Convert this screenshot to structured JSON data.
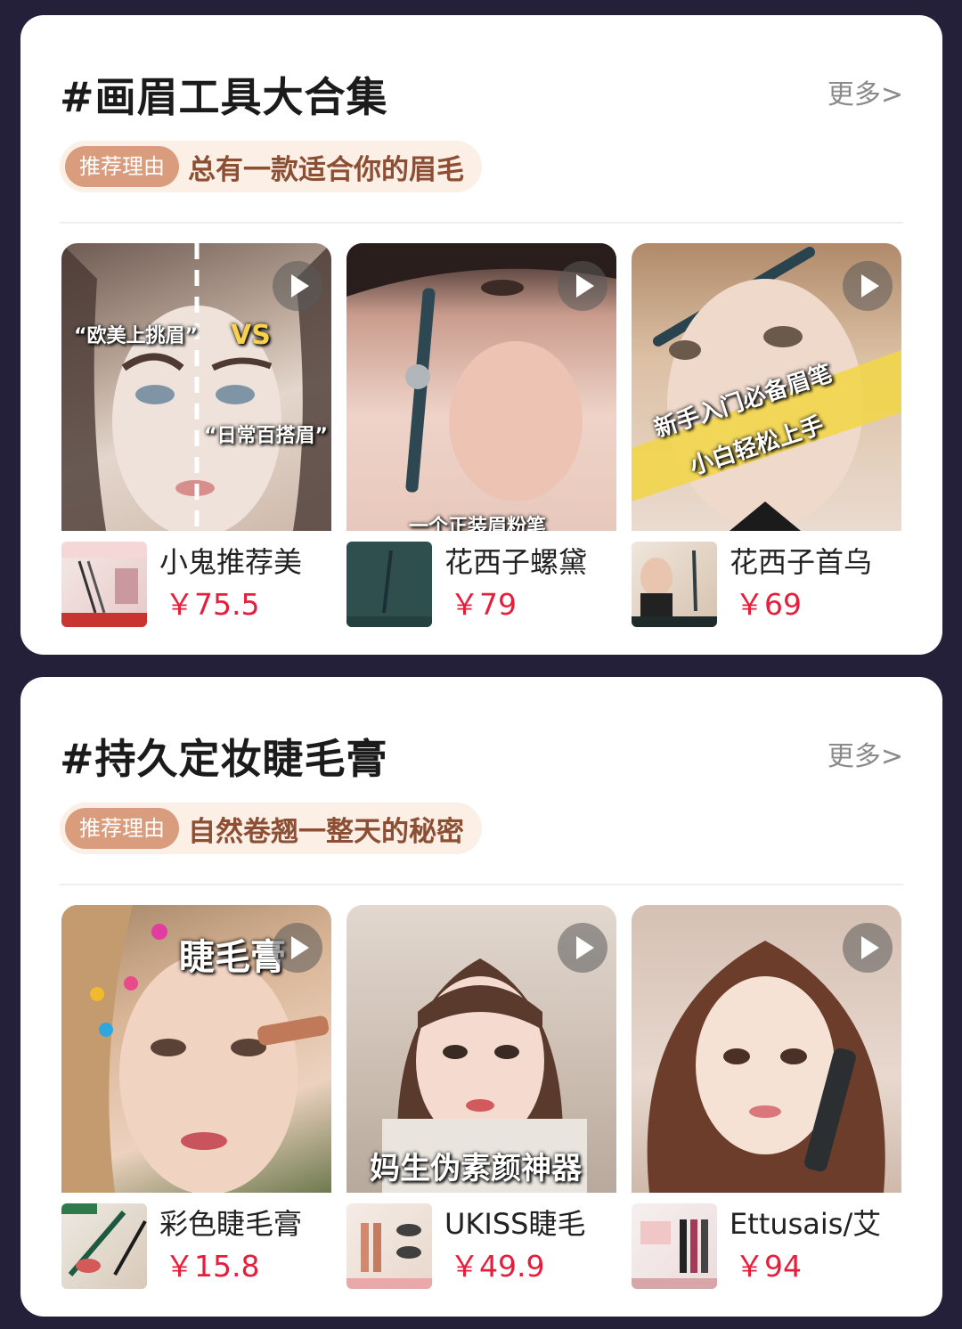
{
  "sections": [
    {
      "title": "#画眉工具大合集",
      "more_label": "更多>",
      "reason_tag": "推荐理由",
      "reason_text": "总有一款适合你的眉毛",
      "items": [
        {
          "video_overlays": [
            "“欧美上挑眉”",
            "VS",
            "“日常百搭眉”"
          ],
          "product_name": "小鬼推荐美",
          "price": "￥75.5",
          "thumb_color": "#b9a79a"
        },
        {
          "video_overlays": [
            "一个正装眉粉笔"
          ],
          "product_name": "花西子螺黛",
          "price": "￥79",
          "thumb_color": "#d8b2a3"
        },
        {
          "video_overlays": [
            "新手入门必备眉笔",
            "小白轻松上手"
          ],
          "product_name": "花西子首乌",
          "price": "￥69",
          "thumb_color": "#c7a58c"
        }
      ]
    },
    {
      "title": "#持久定妆睫毛膏",
      "more_label": "更多>",
      "reason_tag": "推荐理由",
      "reason_text": "自然卷翘一整天的秘密",
      "items": [
        {
          "video_overlays": [
            "睫毛膏"
          ],
          "product_name": "彩色睫毛膏",
          "price": "￥15.8",
          "thumb_color": "#c8a58e"
        },
        {
          "video_overlays": [
            "妈生伪素颜神器"
          ],
          "product_name": "UKISS睫毛",
          "price": "￥49.9",
          "thumb_color": "#d7c6bb"
        },
        {
          "video_overlays": [],
          "product_name": "Ettusais/艾",
          "price": "￥94",
          "thumb_color": "#c9b3a8"
        }
      ]
    }
  ],
  "colors": {
    "background": "#25203a",
    "price": "#e51f3b",
    "reason_tag_bg": "#d99c7c",
    "reason_bg": "#fcefe6"
  },
  "icons": [
    "play-icon"
  ]
}
